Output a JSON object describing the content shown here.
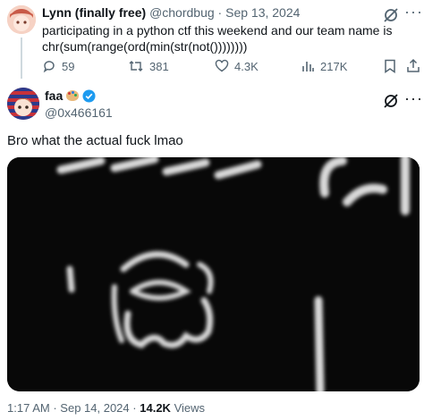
{
  "quoted": {
    "author_name": "Lynn (finally free)",
    "handle": "@chordbug",
    "separator": "·",
    "date": "Sep 13, 2024",
    "text_line1": "participating in a python ctf this weekend and our team name is",
    "text_line2": "chr(sum(range(ord(min(str(not())))))))",
    "actions": {
      "replies": "59",
      "reposts": "381",
      "likes": "4.3K",
      "views": "217K"
    }
  },
  "main": {
    "author_name": "faa",
    "handle": "@0x466161",
    "text": "Bro what the actual fuck lmao",
    "meta_time": "1:17 AM",
    "meta_sep": "·",
    "meta_date": "Sep 14, 2024",
    "meta_sep2": "·",
    "views_count": "14.2K",
    "views_label": "Views"
  },
  "colors": {
    "verified": "#1d9bf0",
    "muted": "#536471",
    "media_bg": "#0b0b0b"
  }
}
